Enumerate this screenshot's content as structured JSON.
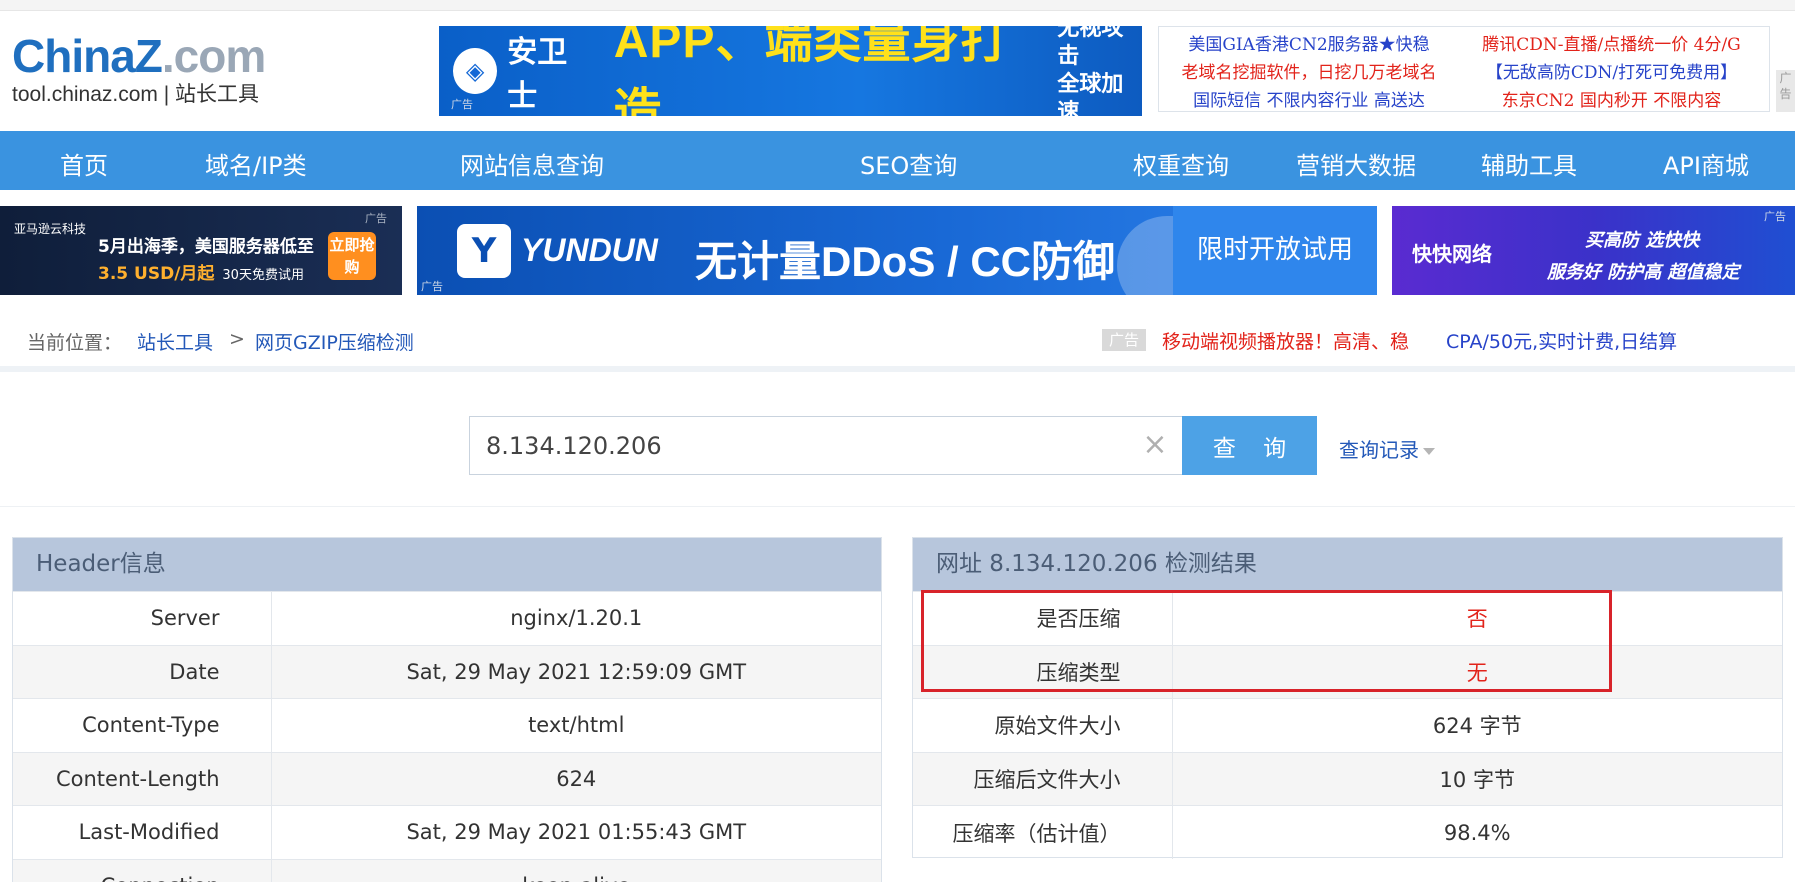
{
  "logo": {
    "main_a": "China",
    "main_z": "Z",
    "main_b": ".com",
    "sub": "tool.chinaz.com | 站长工具"
  },
  "top_banner": {
    "brand": "安卫士",
    "title": "APP、端类量身打造",
    "side_1": "无视攻击",
    "side_2": "全球加速",
    "ad": "广告"
  },
  "text_ads": {
    "left": [
      "美国GIA香港CN2服务器★快稳",
      "老域名挖掘软件，日挖几万老域名",
      "国际短信 不限内容行业 高送达"
    ],
    "right": [
      "腾讯CDN-直播/点播统一价 4分/G",
      "【无敌高防CDN/打死可免费用】",
      "东京CN2 国内秒开 不限内容"
    ],
    "side_tag": "广告"
  },
  "nav": [
    "首页",
    "域名/IP类",
    "网站信息查询",
    "SEO查询",
    "权重查询",
    "营销大数据",
    "辅助工具",
    "API商城"
  ],
  "banner_row": {
    "a": {
      "brand": "亚马逊云科技",
      "line1": "5月出海季，美国服务器低至",
      "line2": "3.5 USD/月起",
      "line2_small": "30天免费试用",
      "btn": "立即抢购",
      "ad": "广告"
    },
    "b": {
      "icon": "Y",
      "brand": "YUNDUN",
      "title": "无计量DDoS / CC防御",
      "trial": "限时开放试用",
      "ad": "广告"
    },
    "c": {
      "brand": "快快网络",
      "line1": "买高防 选快快",
      "line2": "服务好 防护高 超值稳定",
      "ad": "广告"
    }
  },
  "breadcrumb": {
    "label": "当前位置：",
    "home": "站长工具",
    "sep": ">",
    "current": "网页GZIP压缩检测"
  },
  "ad_links": {
    "badge": "广告",
    "red": "移动端视频播放器！高清、稳",
    "blue": "CPA/50元,实时计费,日结算"
  },
  "search": {
    "value": "8.134.120.206",
    "button": "查 询",
    "history": "查询记录"
  },
  "header_panel": {
    "title": "Header信息",
    "rows": [
      {
        "k": "Server",
        "v": "nginx/1.20.1"
      },
      {
        "k": "Date",
        "v": "Sat, 29 May 2021 12:59:09 GMT"
      },
      {
        "k": "Content-Type",
        "v": "text/html"
      },
      {
        "k": "Content-Length",
        "v": "624"
      },
      {
        "k": "Last-Modified",
        "v": "Sat, 29 May 2021 01:55:43 GMT"
      },
      {
        "k": "Connection",
        "v": "keep-alive"
      }
    ]
  },
  "result_panel": {
    "title": "网址 8.134.120.206 检测结果",
    "rows": [
      {
        "k": "是否压缩",
        "v": "否"
      },
      {
        "k": "压缩类型",
        "v": "无"
      },
      {
        "k": "原始文件大小",
        "v": "624 字节"
      },
      {
        "k": "压缩后文件大小",
        "v": "10 字节"
      },
      {
        "k": "压缩率（估计值）",
        "v": "98.4%"
      }
    ]
  },
  "colors": {
    "nav": "#3a93e0",
    "accent_red": "#e2231a",
    "link": "#2358b8",
    "panel_head": "#b7c6dc"
  }
}
